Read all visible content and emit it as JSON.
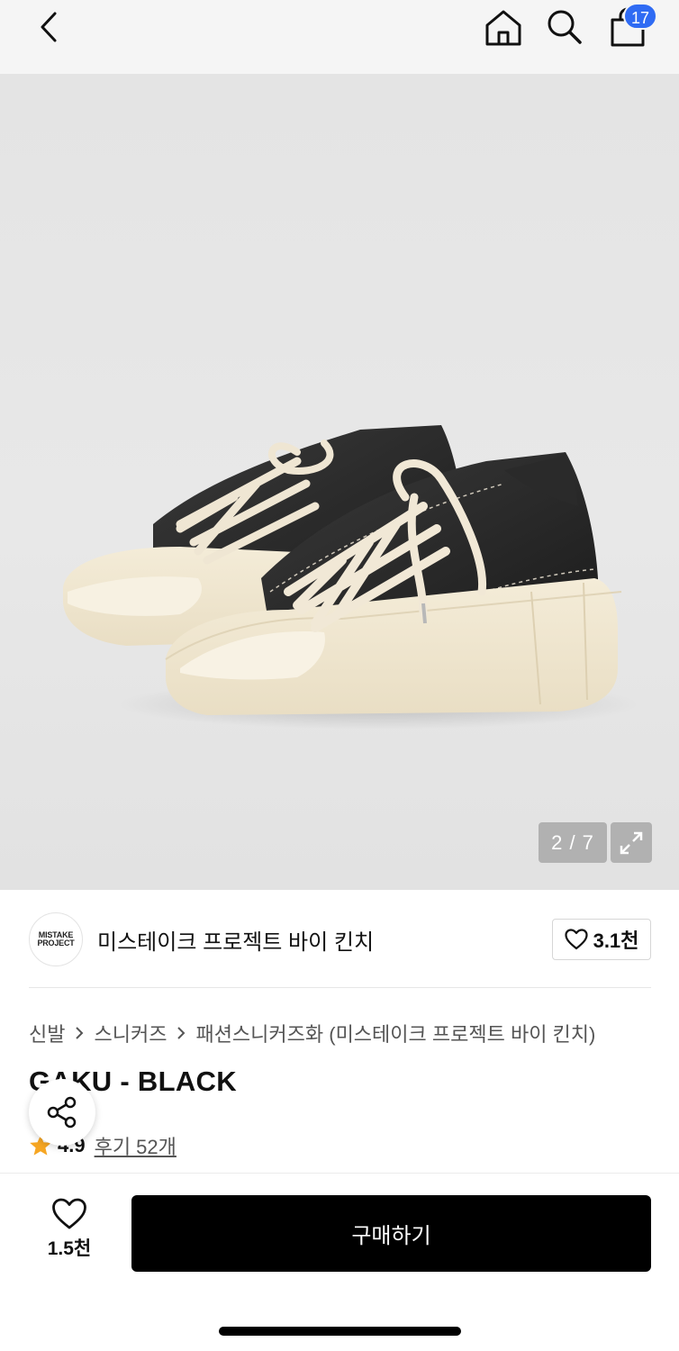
{
  "header": {
    "cart_count": "17"
  },
  "gallery": {
    "counter": "2 / 7"
  },
  "brand": {
    "logo_line1": "MISTAKE",
    "logo_line2": "PROJECT",
    "name": "미스테이크 프로젝트 바이 킨치",
    "likes": "3.1천"
  },
  "breadcrumb": [
    "신발",
    "스니커즈",
    "패션스니커즈화 (미스테이크 프로젝트 바이 킨치)"
  ],
  "product": {
    "title": "GAKU - BLACK",
    "rating": "4.9",
    "reviews": "후기 52개"
  },
  "actions": {
    "wish_count": "1.5천",
    "buy_label": "구매하기"
  },
  "colors": {
    "badge": "#2f6bf3",
    "buy_button": "#000000",
    "star": "#f6a623"
  }
}
